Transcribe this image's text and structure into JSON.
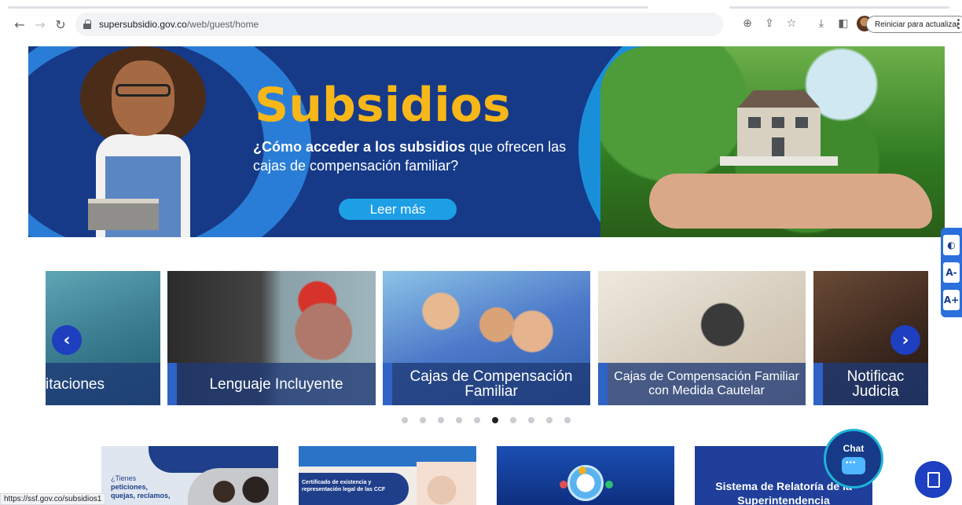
{
  "browser": {
    "url_host": "supersubsidio.gov.co",
    "url_path": "/web/guest/home",
    "update_button": "Reiniciar para actualizar",
    "status_url": "https://ssf.gov.co/subsidios1"
  },
  "hero": {
    "title": "Subsidios",
    "subtitle_bold": "¿Cómo acceder a los subsidios",
    "subtitle_rest": " que ofrecen las cajas de compensación familiar?",
    "cta": "Leer más"
  },
  "accessibility": {
    "contrast": "◐",
    "decrease": "A-",
    "increase": "A+"
  },
  "carousel": {
    "items": [
      {
        "label": "itaciones"
      },
      {
        "label": "Lenguaje Incluyente"
      },
      {
        "label": "Cajas de Compensación Familiar"
      },
      {
        "label": "Cajas de Compensación Familiar con Medida Cautelar"
      },
      {
        "label": "Notificac Judicia"
      }
    ],
    "dots": 10,
    "active_dot": 5
  },
  "tiles": {
    "t1_line1": "¿Tienes",
    "t1_line2": "peticiones,",
    "t1_line3": "quejas, reclamos,",
    "t2_text": "Certificado de existencia y representación legal de las CCF",
    "t4_title": "Sistema de Relatoría de la Superintendencia"
  },
  "chat": {
    "label": "Chat"
  },
  "colors": {
    "brand_blue": "#163a88",
    "accent_yellow": "#f7b718",
    "cta_blue": "#1d9fe6"
  }
}
